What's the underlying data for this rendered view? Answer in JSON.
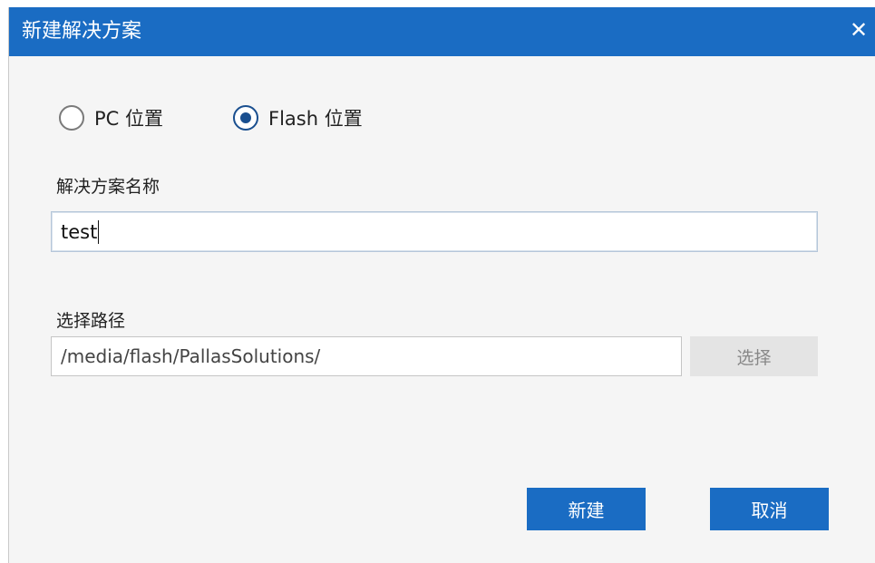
{
  "dialog": {
    "title": "新建解决方案",
    "close_icon": "close-icon"
  },
  "location": {
    "options": [
      {
        "label": "PC 位置",
        "selected": false
      },
      {
        "label": "Flash 位置",
        "selected": true
      }
    ]
  },
  "solution_name": {
    "label": "解决方案名称",
    "value": "test"
  },
  "path": {
    "label": "选择路径",
    "value": "/media/flash/PallasSolutions/",
    "select_label": "选择"
  },
  "actions": {
    "create_label": "新建",
    "cancel_label": "取消"
  },
  "colors": {
    "accent": "#1a6cc3",
    "radio_selected": "#1a4f8f",
    "disabled_button": "#e4e4e4"
  }
}
